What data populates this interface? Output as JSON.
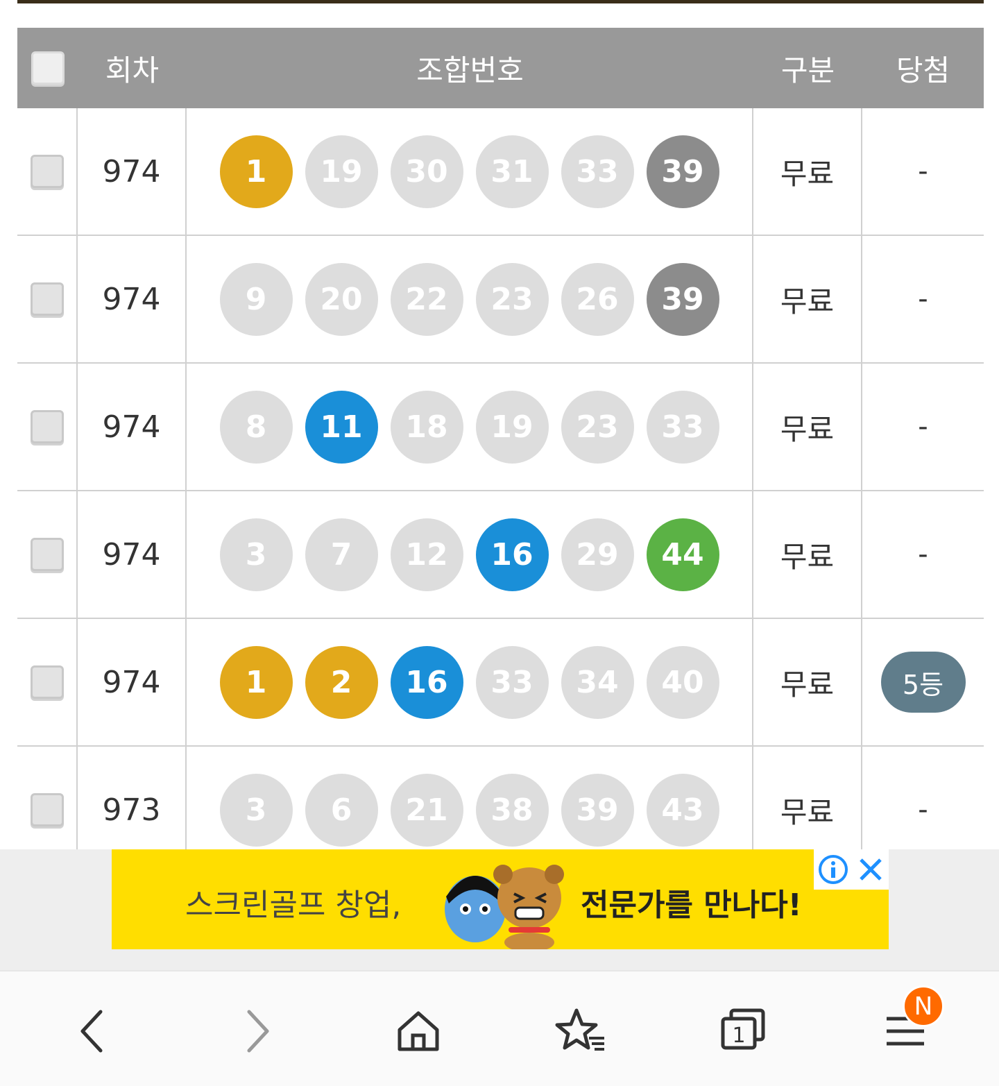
{
  "table": {
    "headers": {
      "round": "회차",
      "combination": "조합번호",
      "type": "구분",
      "win": "당첨"
    },
    "rows": [
      {
        "round": "974",
        "type": "무료",
        "win": "-",
        "balls": [
          {
            "n": "1",
            "color": "#e2a91b"
          },
          {
            "n": "19",
            "color": "#dddddd"
          },
          {
            "n": "30",
            "color": "#dddddd"
          },
          {
            "n": "31",
            "color": "#dddddd"
          },
          {
            "n": "33",
            "color": "#dddddd"
          },
          {
            "n": "39",
            "color": "#8c8c8c"
          }
        ]
      },
      {
        "round": "974",
        "type": "무료",
        "win": "-",
        "balls": [
          {
            "n": "9",
            "color": "#dddddd"
          },
          {
            "n": "20",
            "color": "#dddddd"
          },
          {
            "n": "22",
            "color": "#dddddd"
          },
          {
            "n": "23",
            "color": "#dddddd"
          },
          {
            "n": "26",
            "color": "#dddddd"
          },
          {
            "n": "39",
            "color": "#8c8c8c"
          }
        ]
      },
      {
        "round": "974",
        "type": "무료",
        "win": "-",
        "balls": [
          {
            "n": "8",
            "color": "#dddddd"
          },
          {
            "n": "11",
            "color": "#1a8fd8"
          },
          {
            "n": "18",
            "color": "#dddddd"
          },
          {
            "n": "19",
            "color": "#dddddd"
          },
          {
            "n": "23",
            "color": "#dddddd"
          },
          {
            "n": "33",
            "color": "#dddddd"
          }
        ]
      },
      {
        "round": "974",
        "type": "무료",
        "win": "-",
        "balls": [
          {
            "n": "3",
            "color": "#dddddd"
          },
          {
            "n": "7",
            "color": "#dddddd"
          },
          {
            "n": "12",
            "color": "#dddddd"
          },
          {
            "n": "16",
            "color": "#1a8fd8"
          },
          {
            "n": "29",
            "color": "#dddddd"
          },
          {
            "n": "44",
            "color": "#5bb245"
          }
        ]
      },
      {
        "round": "974",
        "type": "무료",
        "win": "5등",
        "win_badge": true,
        "balls": [
          {
            "n": "1",
            "color": "#e2a91b"
          },
          {
            "n": "2",
            "color": "#e2a91b"
          },
          {
            "n": "16",
            "color": "#1a8fd8"
          },
          {
            "n": "33",
            "color": "#dddddd"
          },
          {
            "n": "34",
            "color": "#dddddd"
          },
          {
            "n": "40",
            "color": "#dddddd"
          }
        ]
      },
      {
        "round": "973",
        "type": "무료",
        "win": "-",
        "balls": [
          {
            "n": "3",
            "color": "#dddddd"
          },
          {
            "n": "6",
            "color": "#dddddd"
          },
          {
            "n": "21",
            "color": "#dddddd"
          },
          {
            "n": "38",
            "color": "#dddddd"
          },
          {
            "n": "39",
            "color": "#dddddd"
          },
          {
            "n": "43",
            "color": "#dddddd"
          }
        ]
      }
    ]
  },
  "ad": {
    "text_left": "스크린골프 창업,",
    "text_right": "전문가를 만나다!",
    "info_icon": "info-icon",
    "close_icon": "close-icon",
    "accent": "#1e90ff",
    "background": "#ffde00"
  },
  "nav": {
    "items": [
      "back-icon",
      "forward-icon",
      "home-icon",
      "bookmark-star-icon",
      "tabs-icon",
      "menu-icon"
    ],
    "tab_count": "1",
    "menu_badge": "N"
  }
}
